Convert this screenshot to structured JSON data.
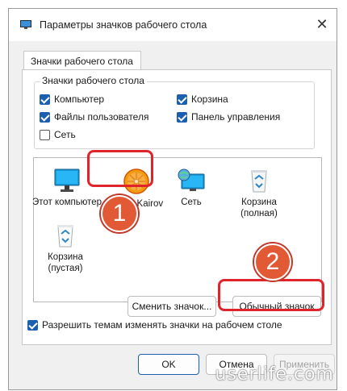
{
  "window": {
    "title": "Параметры значков рабочего стола",
    "close_glyph": "✕"
  },
  "tab": {
    "label": "Значки рабочего стола"
  },
  "group": {
    "title": "Значки рабочего стола",
    "checkboxes": [
      {
        "label": "Компьютер",
        "checked": true
      },
      {
        "label": "Корзина",
        "checked": true
      },
      {
        "label": "Файлы пользователя",
        "checked": true
      },
      {
        "label": "Панель управления",
        "checked": true
      },
      {
        "label": "Сеть",
        "checked": false
      }
    ]
  },
  "icons": [
    {
      "label": "Этот компьютер",
      "icon": "monitor-icon"
    },
    {
      "label": "Vitaliy Kairov",
      "icon": "orange-user-icon",
      "selected": true
    },
    {
      "label": "Сеть",
      "icon": "network-icon"
    },
    {
      "label": "Корзина (полная)",
      "icon": "recycle-bin-full-icon"
    },
    {
      "label": "Корзина (пустая)",
      "icon": "recycle-bin-empty-icon"
    }
  ],
  "buttons": {
    "change_icon": "Сменить значок...",
    "restore_default": "Обычный значок",
    "ok": "OK",
    "cancel": "Отмена",
    "apply": "Применить"
  },
  "themes_checkbox": {
    "label": "Разрешить темам изменять значки на рабочем столе",
    "checked": true
  },
  "annotations": {
    "step1": "1",
    "step2": "2",
    "highlight_color": "#e0242b",
    "badge_color": "#e25a35"
  },
  "watermark": "userlife.com"
}
